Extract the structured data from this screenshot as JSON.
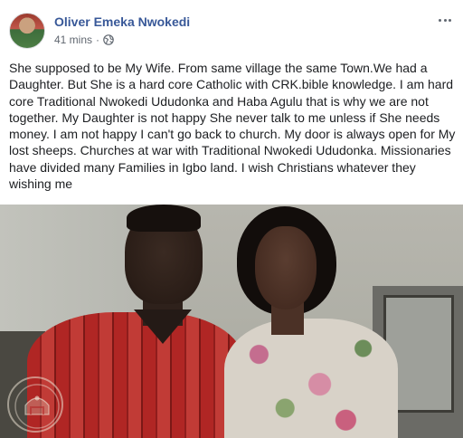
{
  "post": {
    "author": "Oliver Emeka Nwokedi",
    "timestamp": "41 mins",
    "separator": "·",
    "privacy_icon": "globe-icon",
    "more_icon": "more-options-icon",
    "body": "She supposed to be My Wife. From same village the same Town.We had a Daughter. But She is a hard core Catholic with CRK.bible knowledge. I am hard core Traditional Nwokedi Ududonka and Haba Agulu that is why we are not together. My Daughter is not happy She never talk to me unless if She needs money. I am not happy I can't go back to church. My door is always open for My lost sheeps. Churches at war with Traditional Nwokedi Ududonka. Missionaries have divided many Families in Igbo land. I wish Christians whatever they wishing me"
  },
  "photo": {
    "watermark_icon": "seal-watermark-icon"
  },
  "colors": {
    "author_link": "#385898",
    "meta_text": "#606770",
    "body_text": "#1c1e21"
  }
}
